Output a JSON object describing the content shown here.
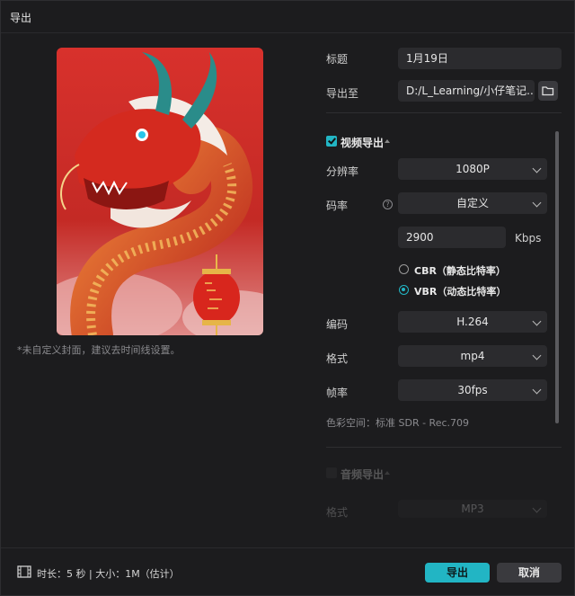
{
  "window": {
    "title": "导出"
  },
  "cover": {
    "hint": "*未自定义封面，建议去时间线设置。"
  },
  "form": {
    "title_label": "标题",
    "title_value": "1月19日",
    "export_to_label": "导出至",
    "export_to_value": "D:/L_Learning/小仔笔记..."
  },
  "video": {
    "section_label": "视频导出",
    "checked": true,
    "resolution_label": "分辨率",
    "resolution_value": "1080P",
    "bitrate_label": "码率",
    "bitrate_value": "自定义",
    "bitrate_number": "2900",
    "bitrate_unit": "Kbps",
    "cbr_label": "CBR（静态比特率）",
    "vbr_label": "VBR（动态比特率）",
    "selected_mode": "VBR",
    "codec_label": "编码",
    "codec_value": "H.264",
    "format_label": "格式",
    "format_value": "mp4",
    "framerate_label": "帧率",
    "framerate_value": "30fps",
    "colorspace_text": "色彩空间：标准 SDR - Rec.709"
  },
  "audio": {
    "section_label": "音频导出",
    "checked": false,
    "format_label": "格式",
    "format_value": "MP3"
  },
  "footer": {
    "info": "时长：5 秒 | 大小：1M（估计）",
    "export_button": "导出",
    "cancel_button": "取消"
  },
  "colors": {
    "accent": "#22b5c4",
    "background": "#1c1c1e",
    "field": "#2b2b2e"
  },
  "icons": [
    "folder-icon",
    "checkbox-icon",
    "caret-up-icon",
    "help-icon",
    "chevron-down-icon",
    "film-icon"
  ]
}
